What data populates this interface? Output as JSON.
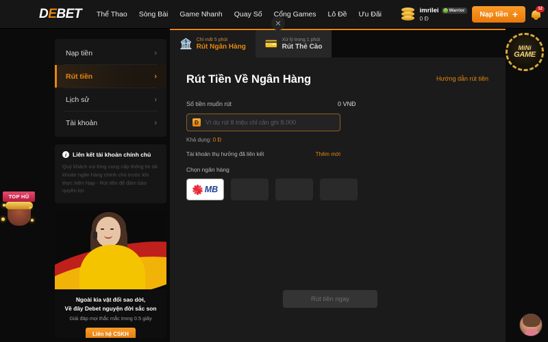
{
  "header": {
    "logo": {
      "part1": "D",
      "part2": "E",
      "part3": "BET"
    },
    "nav": [
      {
        "label": "Thể Thao"
      },
      {
        "label": "Sòng Bài"
      },
      {
        "label": "Game Nhanh"
      },
      {
        "label": "Quay Số"
      },
      {
        "label": "Cổng Games"
      },
      {
        "label": "Lô Đề"
      },
      {
        "label": "Ưu Đãi"
      }
    ],
    "close_icon": "✕",
    "user": {
      "name": "imrilei",
      "balance": "0 Đ",
      "rank": "Warrior"
    },
    "deposit_label": "Nạp tiền",
    "deposit_plus": "+",
    "notification_count": "12"
  },
  "sidebar": {
    "items": [
      {
        "label": "Nạp tiền",
        "chevron": "›",
        "active": false
      },
      {
        "label": "Rút tiền",
        "chevron": "›",
        "active": true
      },
      {
        "label": "Lịch sử",
        "chevron": "›",
        "active": false
      },
      {
        "label": "Tài khoản",
        "chevron": "›",
        "active": false
      }
    ],
    "info": {
      "icon_char": "i",
      "title": "Liên kết tài khoản chính chủ",
      "body": "Quý khách vui lòng cung cấp thông tin tài khoản ngân hàng chính chủ trước khi thực hiện Nạp - Rút tiền để đảm bảo quyền lợi."
    },
    "promo": {
      "line1": "Ngoài kia vật đổi sao dời,",
      "line2": "Về đây Debet nguyện đời sắc son",
      "sub": "Giải đáp mọi thắc mắc trong 0.5 giây",
      "button": "Liên hệ CSKH"
    }
  },
  "main": {
    "tabs": [
      {
        "sub": "Chỉ mất 5 phút",
        "label": "Rút Ngân Hàng",
        "icon": "🏦",
        "active": true
      },
      {
        "sub": "Xử lý trong 1 phút",
        "label": "Rút Thẻ Cào",
        "icon": "💳",
        "active": false
      }
    ],
    "title": "Rút Tiền Về Ngân Hàng",
    "guide_link": "Hướng dẫn rút tiền",
    "amount_label": "Số tiền muốn rút",
    "amount_value": "0 VNĐ",
    "input": {
      "currency_icon": "Đ",
      "placeholder": "Ví dụ rút 8 triệu chỉ cần ghi 8.000",
      "value": ""
    },
    "available_label": "Khả dụng:",
    "available_value": "0 Đ",
    "linked_label": "Tài khoản thụ hưởng đã liên kết",
    "add_new_label": "Thêm mới",
    "choose_bank_label": "Chọn ngân hàng",
    "banks": [
      {
        "name": "MB",
        "selected": true
      },
      {
        "name": "",
        "selected": false
      },
      {
        "name": "",
        "selected": false
      },
      {
        "name": "",
        "selected": false
      }
    ],
    "submit_label": "Rút tiền ngay"
  },
  "widgets": {
    "tophu_label": "TOP HŨ",
    "minigame_line1": "MiNi",
    "minigame_line2": "GAME"
  },
  "colors": {
    "accent": "#e8870f",
    "page_bg": "#0b0b0b",
    "panel_bg": "#1b1b1b",
    "card_bg": "#161616"
  }
}
